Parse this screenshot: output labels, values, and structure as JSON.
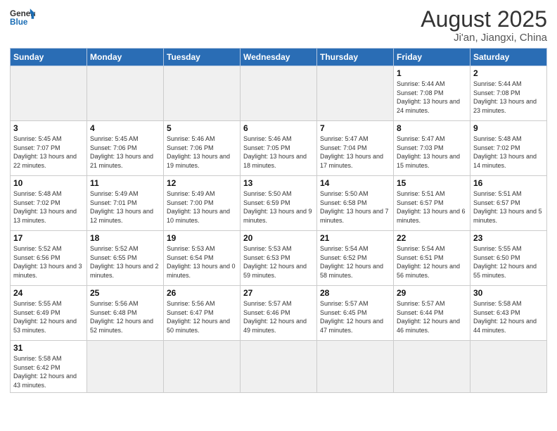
{
  "header": {
    "logo_general": "General",
    "logo_blue": "Blue",
    "month_title": "August 2025",
    "location": "Ji'an, Jiangxi, China"
  },
  "days_of_week": [
    "Sunday",
    "Monday",
    "Tuesday",
    "Wednesday",
    "Thursday",
    "Friday",
    "Saturday"
  ],
  "weeks": [
    [
      {
        "day": "",
        "empty": true
      },
      {
        "day": "",
        "empty": true
      },
      {
        "day": "",
        "empty": true
      },
      {
        "day": "",
        "empty": true
      },
      {
        "day": "",
        "empty": true
      },
      {
        "day": "1",
        "sunrise": "5:44 AM",
        "sunset": "7:08 PM",
        "daylight": "13 hours and 24 minutes."
      },
      {
        "day": "2",
        "sunrise": "5:44 AM",
        "sunset": "7:08 PM",
        "daylight": "13 hours and 23 minutes."
      }
    ],
    [
      {
        "day": "3",
        "sunrise": "5:45 AM",
        "sunset": "7:07 PM",
        "daylight": "13 hours and 22 minutes."
      },
      {
        "day": "4",
        "sunrise": "5:45 AM",
        "sunset": "7:06 PM",
        "daylight": "13 hours and 21 minutes."
      },
      {
        "day": "5",
        "sunrise": "5:46 AM",
        "sunset": "7:06 PM",
        "daylight": "13 hours and 19 minutes."
      },
      {
        "day": "6",
        "sunrise": "5:46 AM",
        "sunset": "7:05 PM",
        "daylight": "13 hours and 18 minutes."
      },
      {
        "day": "7",
        "sunrise": "5:47 AM",
        "sunset": "7:04 PM",
        "daylight": "13 hours and 17 minutes."
      },
      {
        "day": "8",
        "sunrise": "5:47 AM",
        "sunset": "7:03 PM",
        "daylight": "13 hours and 15 minutes."
      },
      {
        "day": "9",
        "sunrise": "5:48 AM",
        "sunset": "7:02 PM",
        "daylight": "13 hours and 14 minutes."
      }
    ],
    [
      {
        "day": "10",
        "sunrise": "5:48 AM",
        "sunset": "7:02 PM",
        "daylight": "13 hours and 13 minutes."
      },
      {
        "day": "11",
        "sunrise": "5:49 AM",
        "sunset": "7:01 PM",
        "daylight": "13 hours and 12 minutes."
      },
      {
        "day": "12",
        "sunrise": "5:49 AM",
        "sunset": "7:00 PM",
        "daylight": "13 hours and 10 minutes."
      },
      {
        "day": "13",
        "sunrise": "5:50 AM",
        "sunset": "6:59 PM",
        "daylight": "13 hours and 9 minutes."
      },
      {
        "day": "14",
        "sunrise": "5:50 AM",
        "sunset": "6:58 PM",
        "daylight": "13 hours and 7 minutes."
      },
      {
        "day": "15",
        "sunrise": "5:51 AM",
        "sunset": "6:57 PM",
        "daylight": "13 hours and 6 minutes."
      },
      {
        "day": "16",
        "sunrise": "5:51 AM",
        "sunset": "6:57 PM",
        "daylight": "13 hours and 5 minutes."
      }
    ],
    [
      {
        "day": "17",
        "sunrise": "5:52 AM",
        "sunset": "6:56 PM",
        "daylight": "13 hours and 3 minutes."
      },
      {
        "day": "18",
        "sunrise": "5:52 AM",
        "sunset": "6:55 PM",
        "daylight": "13 hours and 2 minutes."
      },
      {
        "day": "19",
        "sunrise": "5:53 AM",
        "sunset": "6:54 PM",
        "daylight": "13 hours and 0 minutes."
      },
      {
        "day": "20",
        "sunrise": "5:53 AM",
        "sunset": "6:53 PM",
        "daylight": "12 hours and 59 minutes."
      },
      {
        "day": "21",
        "sunrise": "5:54 AM",
        "sunset": "6:52 PM",
        "daylight": "12 hours and 58 minutes."
      },
      {
        "day": "22",
        "sunrise": "5:54 AM",
        "sunset": "6:51 PM",
        "daylight": "12 hours and 56 minutes."
      },
      {
        "day": "23",
        "sunrise": "5:55 AM",
        "sunset": "6:50 PM",
        "daylight": "12 hours and 55 minutes."
      }
    ],
    [
      {
        "day": "24",
        "sunrise": "5:55 AM",
        "sunset": "6:49 PM",
        "daylight": "12 hours and 53 minutes."
      },
      {
        "day": "25",
        "sunrise": "5:56 AM",
        "sunset": "6:48 PM",
        "daylight": "12 hours and 52 minutes."
      },
      {
        "day": "26",
        "sunrise": "5:56 AM",
        "sunset": "6:47 PM",
        "daylight": "12 hours and 50 minutes."
      },
      {
        "day": "27",
        "sunrise": "5:57 AM",
        "sunset": "6:46 PM",
        "daylight": "12 hours and 49 minutes."
      },
      {
        "day": "28",
        "sunrise": "5:57 AM",
        "sunset": "6:45 PM",
        "daylight": "12 hours and 47 minutes."
      },
      {
        "day": "29",
        "sunrise": "5:57 AM",
        "sunset": "6:44 PM",
        "daylight": "12 hours and 46 minutes."
      },
      {
        "day": "30",
        "sunrise": "5:58 AM",
        "sunset": "6:43 PM",
        "daylight": "12 hours and 44 minutes."
      }
    ],
    [
      {
        "day": "31",
        "sunrise": "5:58 AM",
        "sunset": "6:42 PM",
        "daylight": "12 hours and 43 minutes."
      },
      {
        "day": "",
        "empty": true
      },
      {
        "day": "",
        "empty": true
      },
      {
        "day": "",
        "empty": true
      },
      {
        "day": "",
        "empty": true
      },
      {
        "day": "",
        "empty": true
      },
      {
        "day": "",
        "empty": true
      }
    ]
  ]
}
